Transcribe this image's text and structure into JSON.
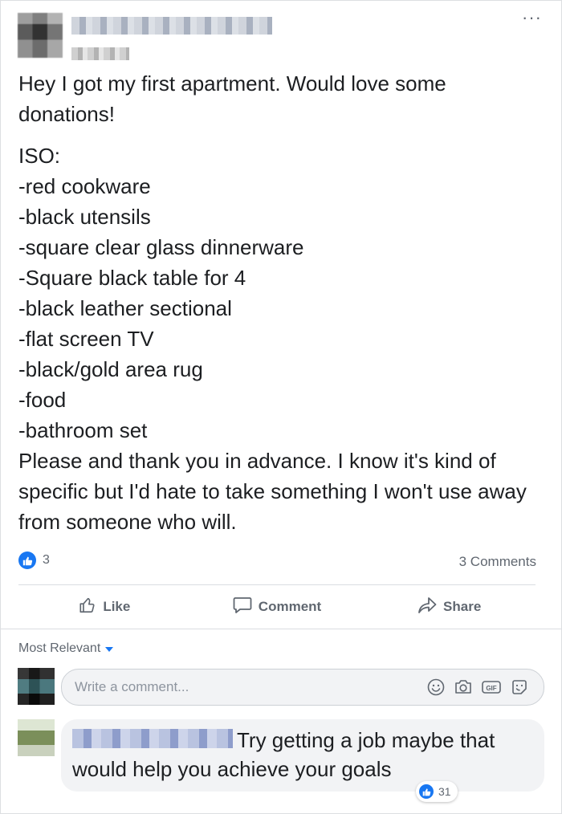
{
  "post": {
    "text_para1": "Hey I got my first apartment. Would love some donations!",
    "text_list_header": "ISO:",
    "list_items": [
      "-red cookware",
      "-black utensils",
      "-square clear glass dinnerware",
      "-Square black table for 4",
      "-black leather sectional",
      "-flat screen TV",
      "-black/gold area rug",
      "-food",
      "-bathroom set"
    ],
    "text_closing": "Please and thank you in advance. I know it's kind of specific but I'd hate to take something I won't use away from someone who will.",
    "more_icon": "···"
  },
  "reactions": {
    "count": "3",
    "comments": "3 Comments"
  },
  "actions": {
    "like": "Like",
    "comment": "Comment",
    "share": "Share"
  },
  "comments_section": {
    "sort_label": "Most Relevant",
    "input_placeholder": "Write a comment...",
    "comment_text": "Try getting a job maybe that would help you achieve your goals",
    "comment_likes": "31"
  },
  "colors": {
    "accent": "#1877f2",
    "muted": "#606770"
  }
}
